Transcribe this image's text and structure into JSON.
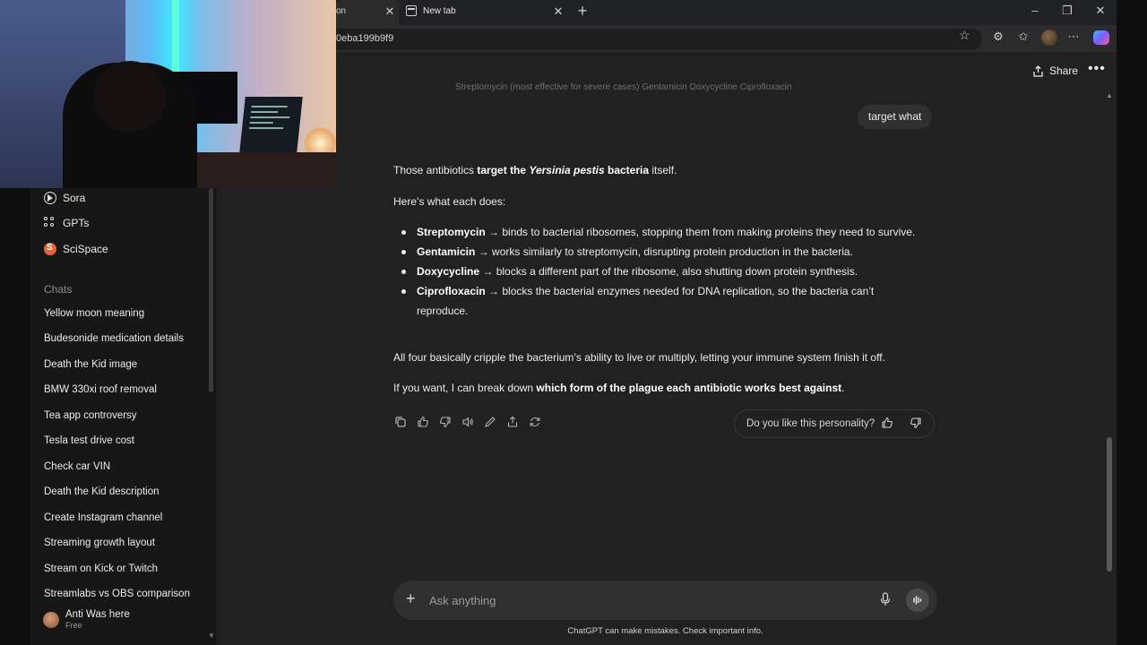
{
  "browser": {
    "tabs": [
      {
        "label": "on"
      },
      {
        "label": "New tab"
      }
    ],
    "url": "0eba199b9f9"
  },
  "sidebar": {
    "nav": [
      {
        "label": "Sora",
        "icon": "sora-icon"
      },
      {
        "label": "GPTs",
        "icon": "gpts-icon"
      },
      {
        "label": "SciSpace",
        "icon": "scispace-icon"
      }
    ],
    "chats_heading": "Chats",
    "chats": [
      "Yellow moon meaning",
      "Budesonide medication details",
      "Death the Kid image",
      "BMW 330xi roof removal",
      "Tea app controversy",
      "Tesla test drive cost",
      "Check car VIN",
      "Death the Kid description",
      "Create Instagram channel",
      "Streaming growth layout",
      "Stream on Kick or Twitch",
      "Streamlabs vs OBS comparison"
    ],
    "user": {
      "name": "Anti Was here",
      "plan": "Free"
    }
  },
  "header": {
    "share_label": "Share"
  },
  "conversation": {
    "previous_line_cutoff": "Streptomycin (most effective for severe cases)   Gentamicin   Doxycycline   Ciprofloxacin",
    "user_message": "target what",
    "intro": {
      "pre": "Those antibiotics ",
      "bold1": "target the ",
      "italic": "Yersinia pestis",
      "bold2": " bacteria",
      "post": " itself."
    },
    "lead": "Here’s what each does:",
    "bullets": [
      {
        "term": "Streptomycin",
        "text": " → binds to bacterial ribosomes, stopping them from making proteins they need to survive."
      },
      {
        "term": "Gentamicin",
        "text": " → works similarly to streptomycin, disrupting protein production in the bacteria."
      },
      {
        "term": "Doxycycline",
        "text": " → blocks a different part of the ribosome, also shutting down protein synthesis."
      },
      {
        "term": "Ciprofloxacin",
        "text": " → blocks the bacterial enzymes needed for DNA replication, so the bacteria can’t reproduce."
      }
    ],
    "summary": "All four basically cripple the bacterium’s ability to live or multiply, letting your immune system finish it off.",
    "offer": {
      "pre": "If you want, I can break down ",
      "bold": "which form of the plague each antibiotic works best against",
      "post": "."
    },
    "feedback_question": "Do you like this personality?"
  },
  "composer": {
    "placeholder": "Ask anything",
    "disclaimer": "ChatGPT can make mistakes. Check important info."
  }
}
